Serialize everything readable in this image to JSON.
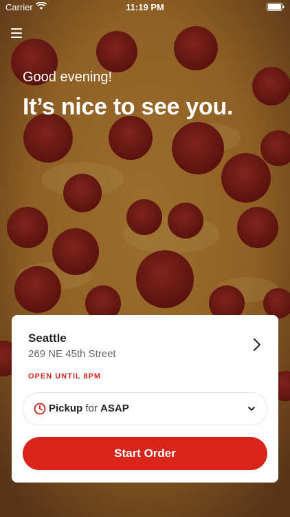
{
  "status_bar": {
    "carrier": "Carrier",
    "time": "11:19 PM"
  },
  "hero": {
    "greeting": "Good evening!",
    "headline": "It’s nice to see you."
  },
  "store": {
    "name": "Seattle",
    "address": "269 NE 45th Street",
    "hours_status": "OPEN UNTIL 8PM"
  },
  "order": {
    "method": "Pickup",
    "connector": "for",
    "time": "ASAP"
  },
  "actions": {
    "start_order_label": "Start Order"
  },
  "colors": {
    "accent": "#d8241b",
    "status_red": "#d0241c",
    "card_background": "#ffffff"
  },
  "icons": {
    "menu": "hamburger-menu-icon",
    "store_chevron": "chevron-right-icon",
    "order_time": "clock-icon",
    "order_dropdown": "chevron-down-icon",
    "wifi": "wifi-icon",
    "battery": "battery-icon"
  }
}
